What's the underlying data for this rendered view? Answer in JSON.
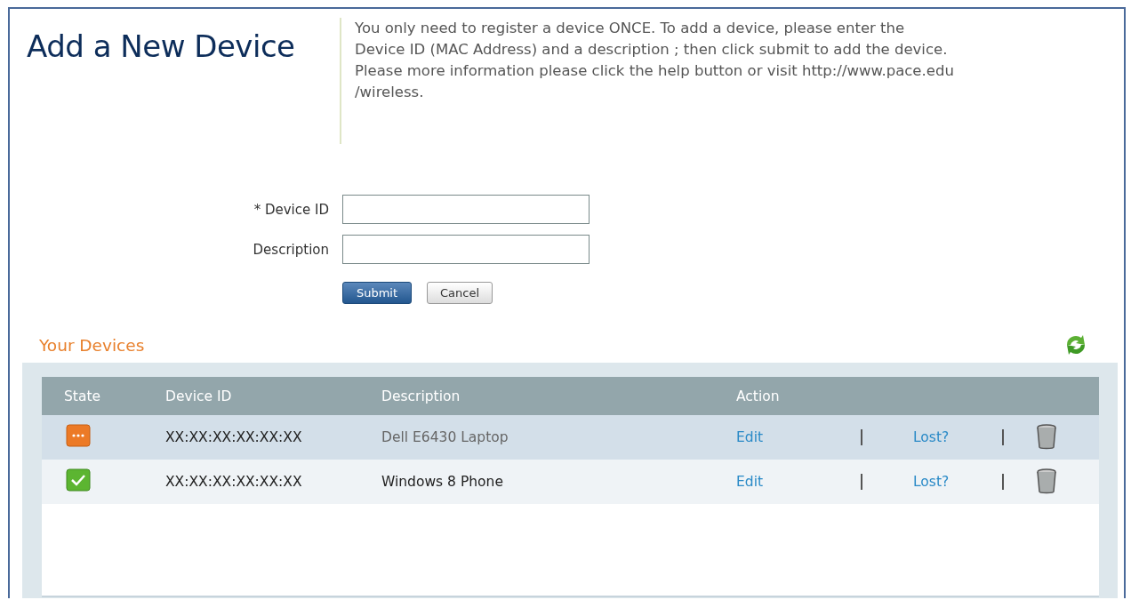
{
  "title": "Add a New Device",
  "intro_lines": [
    "You only need to register a device ONCE. To add a device, please enter the",
    "Device ID (MAC Address) and a description ; then click submit to add the device.",
    "Please more information please click the help button or visit http://www.pace.edu",
    "/wireless."
  ],
  "form": {
    "fields": [
      {
        "label": "* Device ID"
      },
      {
        "label": "Description"
      }
    ],
    "buttons": [
      {
        "label": "Submit",
        "kind": "primary"
      },
      {
        "label": "Cancel",
        "kind": "secondary"
      }
    ]
  },
  "devices": {
    "heading": "Your Devices",
    "columns": [
      "State",
      "Device ID",
      "Description",
      "Action"
    ],
    "rows": [
      {
        "kind": "pending",
        "selected": true,
        "device_id": "XX:XX:XX:XX:XX:XX",
        "description": "Dell E6430 Laptop",
        "edit": "Edit",
        "lost": "Lost?"
      },
      {
        "kind": "active",
        "selected": false,
        "device_id": "XX:XX:XX:XX:XX:XX",
        "description": "Windows 8 Phone",
        "edit": "Edit",
        "lost": "Lost?"
      }
    ]
  }
}
